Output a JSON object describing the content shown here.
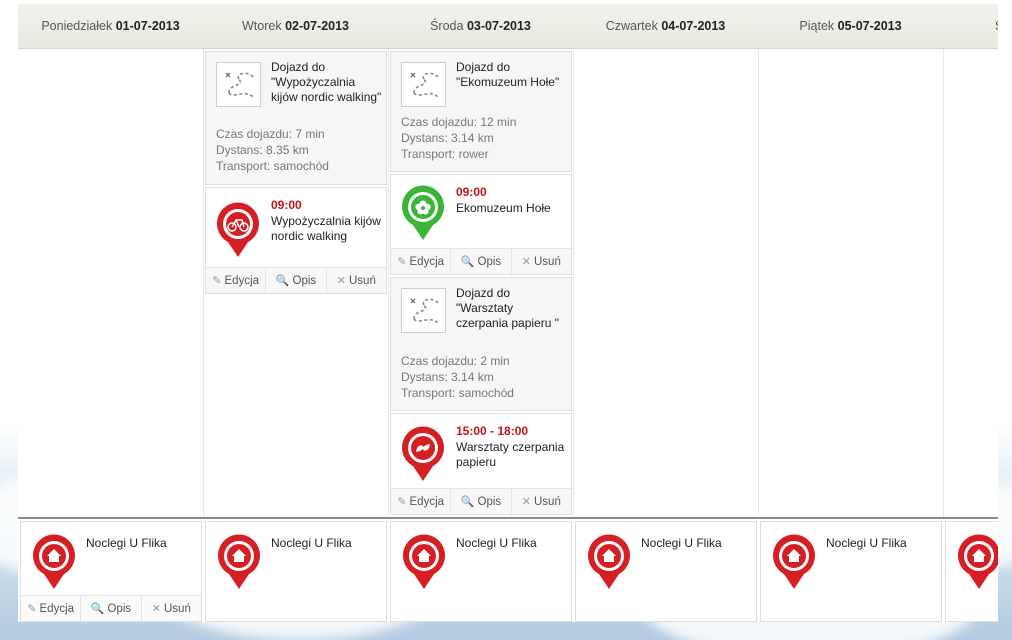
{
  "days": [
    {
      "weekday": "Poniedziałek",
      "date": "01-07-2013"
    },
    {
      "weekday": "Wtorek",
      "date": "02-07-2013"
    },
    {
      "weekday": "Środa",
      "date": "03-07-2013"
    },
    {
      "weekday": "Czwartek",
      "date": "04-07-2013"
    },
    {
      "weekday": "Piątek",
      "date": "05-07-2013"
    },
    {
      "weekday": "So",
      "date": ""
    }
  ],
  "actions": {
    "edit": "Edycja",
    "details": "Opis",
    "delete": "Usuń"
  },
  "tuesday": {
    "route": {
      "title": "Dojazd do \"Wypożyczalnia kijów nordic walking\"",
      "time": "Czas dojazdu: 7 min",
      "distance": "Dystans: 8.35 km",
      "transport": "Transport: samochód"
    },
    "event": {
      "time": "09:00",
      "name": "Wypożyczalnia kijów nordic walking"
    }
  },
  "wednesday": {
    "route1": {
      "title": "Dojazd do \"Ekomuzeum Hołe\"",
      "time": "Czas dojazdu: 12 min",
      "distance": "Dystans: 3.14 km",
      "transport": "Transport: rower"
    },
    "event1": {
      "time": "09:00",
      "name": "Ekomuzeum Hołe"
    },
    "route2": {
      "title": "Dojazd do \"Warsztaty czerpania papieru \"",
      "time": "Czas dojazdu: 2 min",
      "distance": "Dystans: 3.14 km",
      "transport": "Transport: samochód"
    },
    "event2": {
      "time": "15:00 - 18:00",
      "name": "Warsztaty czerpania papieru"
    }
  },
  "lodging": {
    "name": "Noclegi U Flika"
  },
  "colors": {
    "pin_red": "#d51f25",
    "pin_green": "#3ab53a",
    "time_red": "#c0141a"
  },
  "icons": {
    "route": "route-map-icon",
    "bike": "bicycle-icon",
    "museum": "flower-icon",
    "workshop": "hands-icon",
    "house": "house-icon",
    "edit": "pencil-icon",
    "details": "magnifier-icon",
    "delete": "close-icon"
  }
}
